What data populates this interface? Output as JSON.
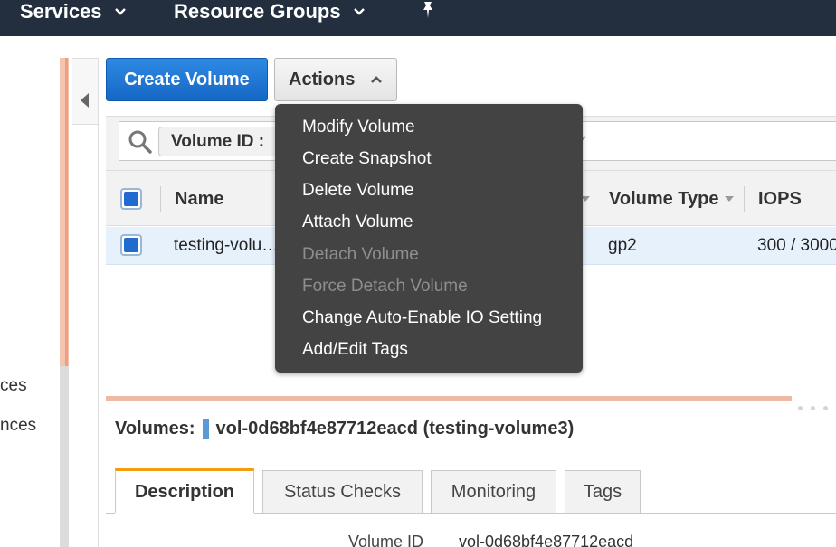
{
  "topnav": {
    "services_label": "Services",
    "resource_groups_label": "Resource Groups",
    "pin_icon": "pin-icon"
  },
  "sidebar": {
    "partial_items": [
      "ces",
      "nces"
    ]
  },
  "toolbar": {
    "create_volume_label": "Create Volume",
    "actions_label": "Actions"
  },
  "search": {
    "token_label": "Volume ID :"
  },
  "table": {
    "columns": [
      "Name",
      "Volume Type",
      "IOPS"
    ],
    "rows": [
      {
        "name": "testing-volu…",
        "volume_type": "gp2",
        "iops": "300 / 3000"
      }
    ]
  },
  "actions_menu": {
    "items": [
      {
        "label": "Modify Volume",
        "enabled": true
      },
      {
        "label": "Create Snapshot",
        "enabled": true
      },
      {
        "label": "Delete Volume",
        "enabled": true
      },
      {
        "label": "Attach Volume",
        "enabled": true
      },
      {
        "label": "Detach Volume",
        "enabled": false
      },
      {
        "label": "Force Detach Volume",
        "enabled": false
      },
      {
        "label": "Change Auto-Enable IO Setting",
        "enabled": true
      },
      {
        "label": "Add/Edit Tags",
        "enabled": true
      }
    ]
  },
  "details": {
    "heading_label": "Volumes:",
    "heading_value": "vol-0d68bf4e87712eacd (testing-volume3)",
    "tabs": [
      "Description",
      "Status Checks",
      "Monitoring",
      "Tags"
    ],
    "active_tab": "Description",
    "fields": [
      {
        "label": "Volume ID",
        "value": "vol-0d68bf4e87712eacd"
      }
    ]
  },
  "colors": {
    "nav_bg": "#232f3e",
    "primary_button": "#1f6bd0",
    "active_tab_accent": "#f39c12",
    "menu_bg": "#434343",
    "selected_row": "#e7f1fb"
  }
}
